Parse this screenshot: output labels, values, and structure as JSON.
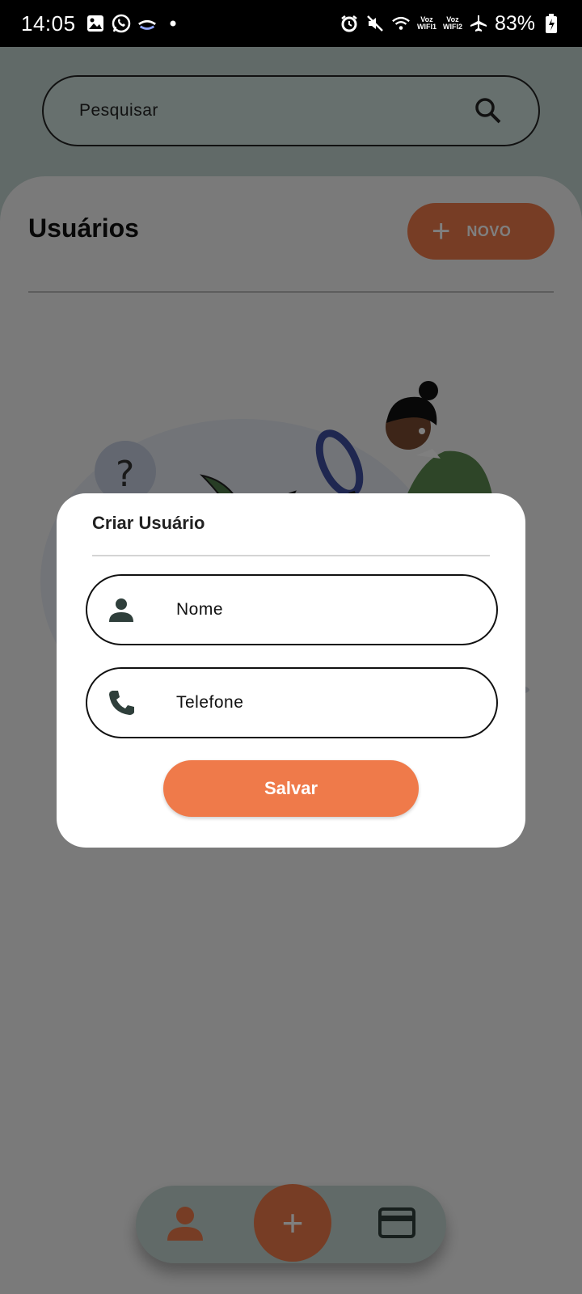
{
  "status_bar": {
    "time": "14:05",
    "battery": "83%",
    "network_label_1": "Voz",
    "network_sub_1": "WIFI1",
    "network_label_2": "Voz",
    "network_sub_2": "WIFI2",
    "left_icons": [
      "gallery-icon",
      "whatsapp-icon",
      "app-icon",
      "dot-icon"
    ],
    "right_icons": [
      "alarm-icon",
      "mute-icon",
      "wifi-icon",
      "airplane-icon",
      "battery-charging-icon"
    ]
  },
  "search": {
    "placeholder": "Pesquisar"
  },
  "page": {
    "title": "Usuários",
    "new_button_label": "NOVO"
  },
  "dialog": {
    "title": "Criar Usuário",
    "fields": [
      {
        "icon": "person-icon",
        "placeholder": "Nome"
      },
      {
        "icon": "phone-icon",
        "placeholder": "Telefone"
      }
    ],
    "save_label": "Salvar"
  },
  "bottom_nav": {
    "items": [
      "person-icon",
      "add-icon",
      "credit-card-icon"
    ],
    "add_symbol": "+"
  },
  "colors": {
    "accent": "#ef7a4a",
    "header_bg": "#c3d4d0",
    "overlay": "rgba(0,0,0,0.5)",
    "icon_dark": "#2f3f3b"
  }
}
